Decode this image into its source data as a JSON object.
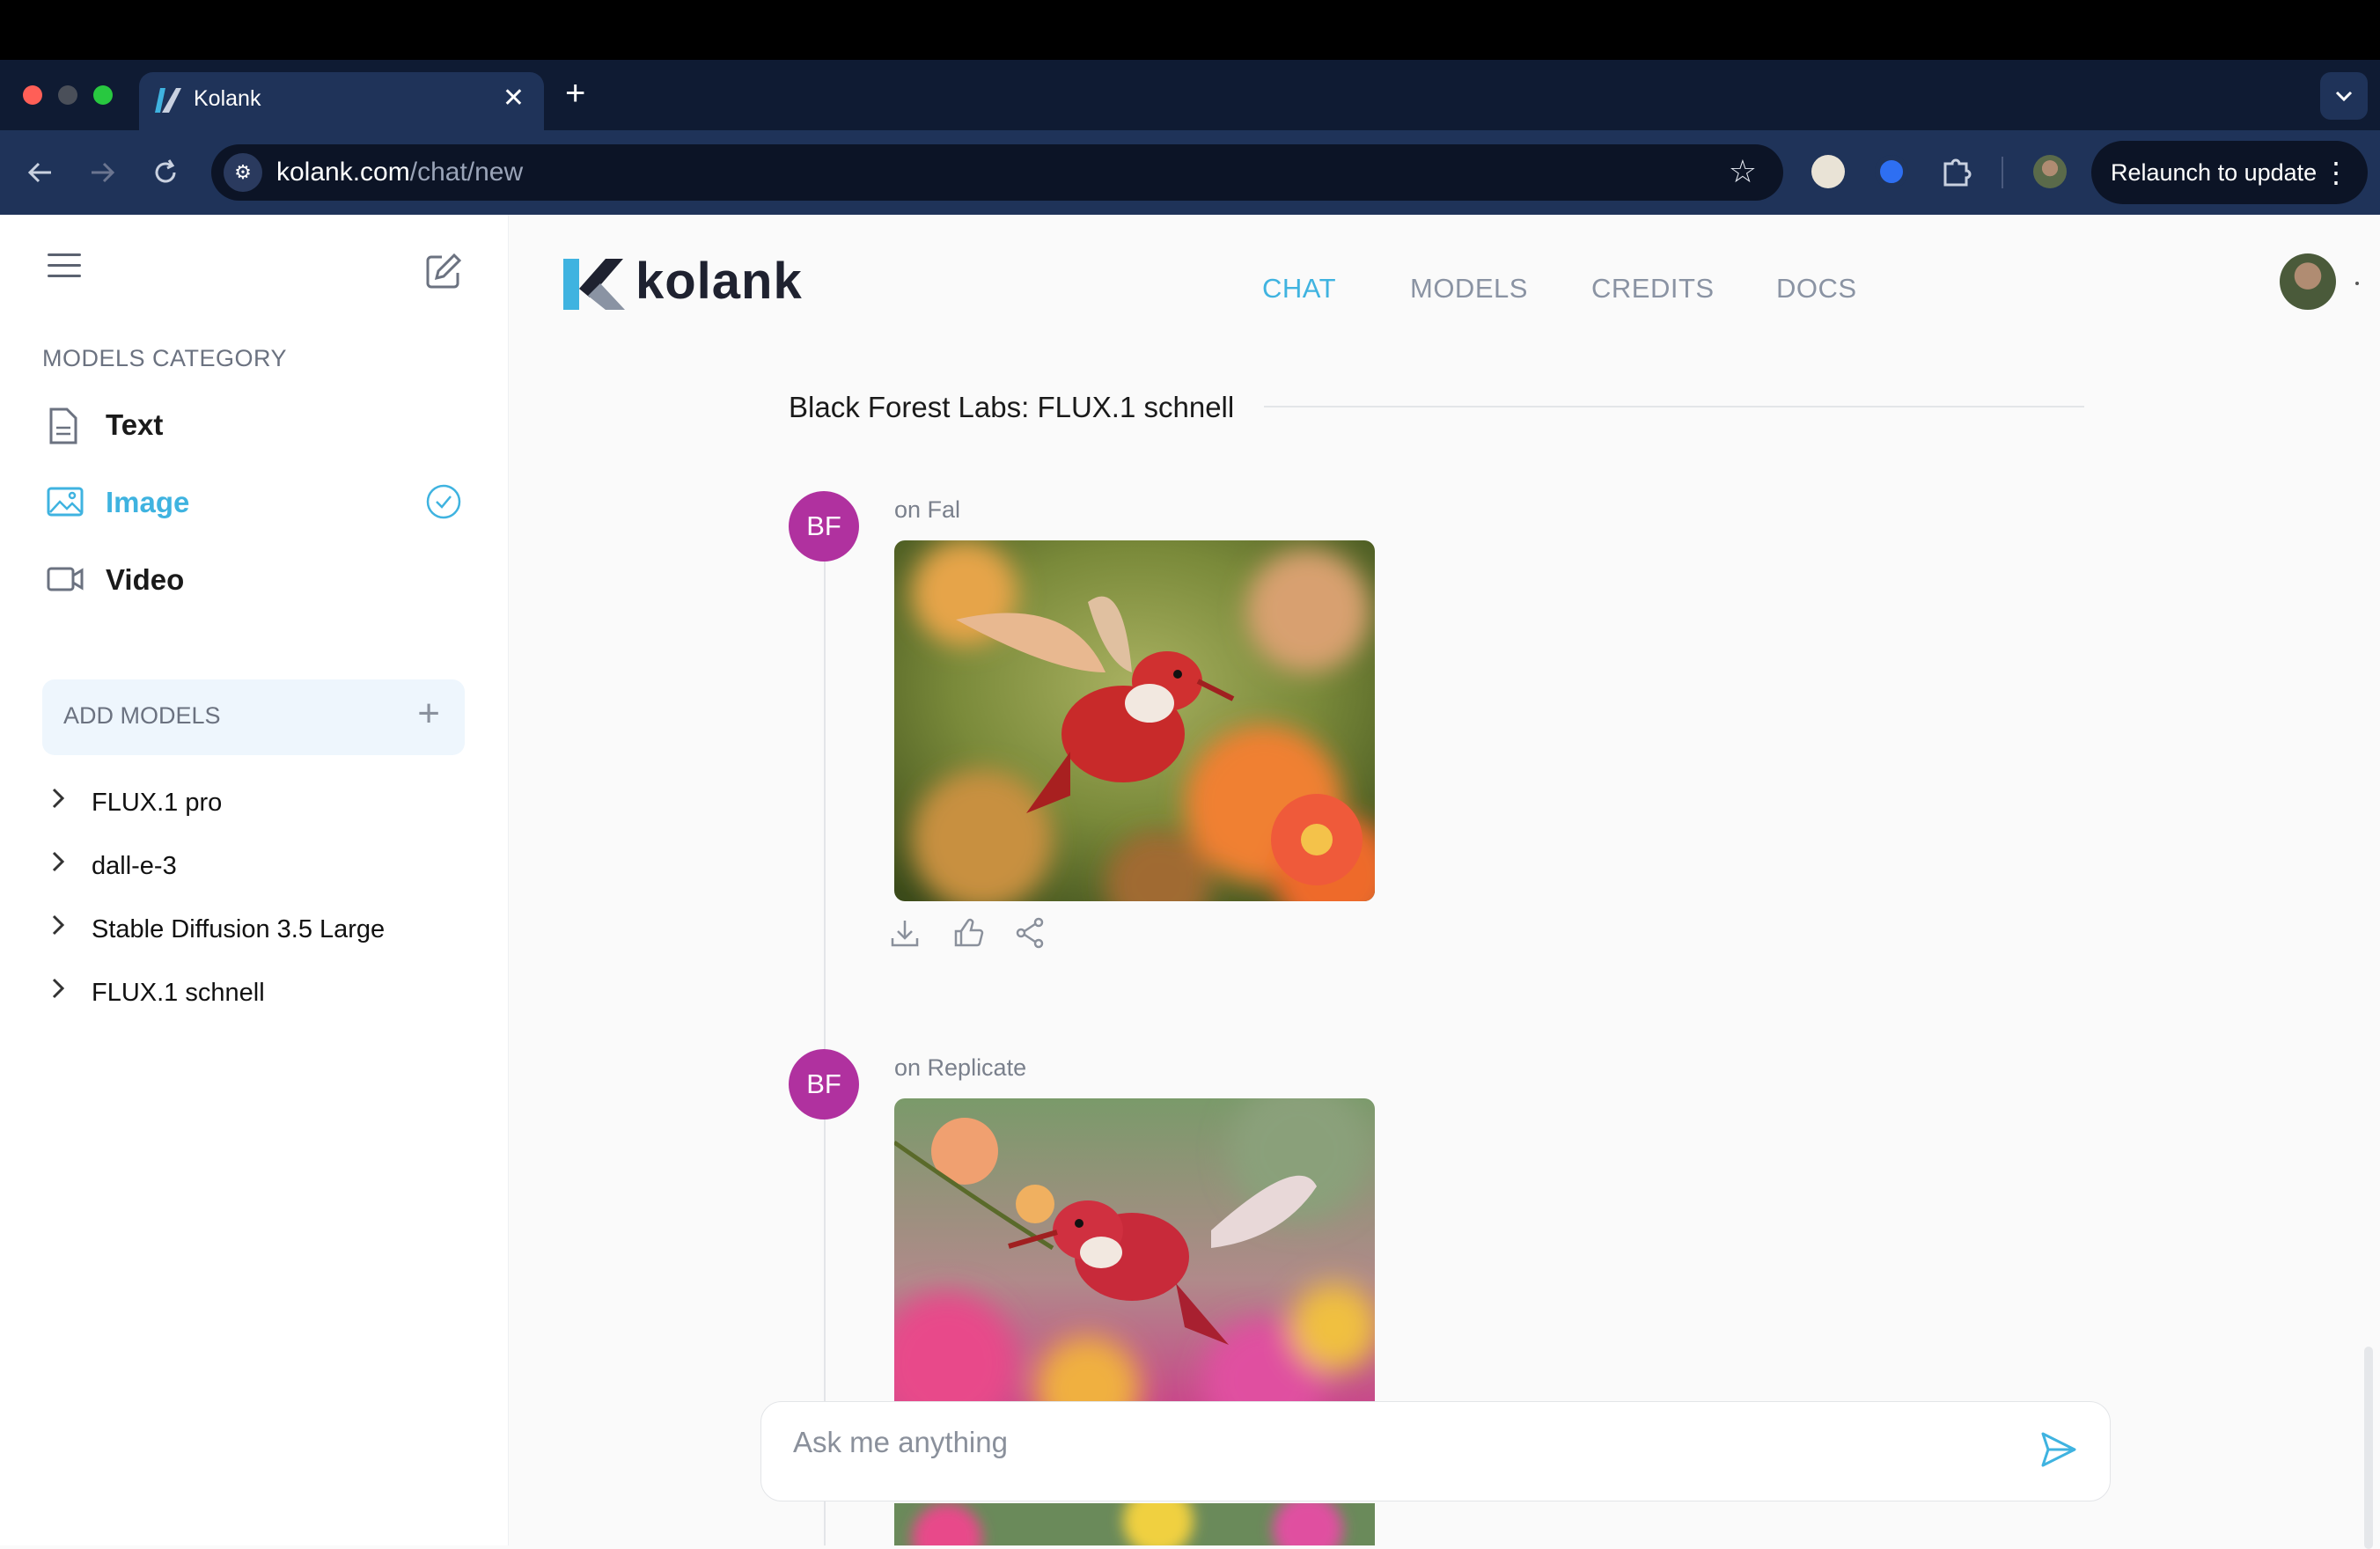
{
  "browser": {
    "tab_title": "Kolank",
    "url_host": "kolank.com",
    "url_path": "/chat/new",
    "relaunch_label": "Relaunch to update",
    "tab_close": "✕",
    "new_tab": "+",
    "menu_dots": "⋮"
  },
  "sidebar": {
    "models_category_label": "MODELS CATEGORY",
    "categories": [
      {
        "label": "Text",
        "icon": "document-icon",
        "selected": false
      },
      {
        "label": "Image",
        "icon": "image-icon",
        "selected": true
      },
      {
        "label": "Video",
        "icon": "video-icon",
        "selected": false
      }
    ],
    "add_models_label": "ADD MODELS",
    "models": [
      {
        "label": "FLUX.1 pro"
      },
      {
        "label": "dall-e-3"
      },
      {
        "label": "Stable Diffusion 3.5 Large"
      },
      {
        "label": "FLUX.1 schnell"
      }
    ]
  },
  "header": {
    "logo_text": "kolank",
    "nav": [
      {
        "label": "CHAT",
        "active": true
      },
      {
        "label": "MODELS",
        "active": false
      },
      {
        "label": "CREDITS",
        "active": false
      },
      {
        "label": "DOCS",
        "active": false
      }
    ]
  },
  "chat": {
    "section_title": "Black Forest Labs: FLUX.1 schnell",
    "messages": [
      {
        "avatar": "BF",
        "source": "on Fal",
        "image_subject": "red hummingbird flying over orange flowers"
      },
      {
        "avatar": "BF",
        "source": "on Replicate",
        "image_subject": "red hummingbird near pink flowers"
      }
    ],
    "input_placeholder": "Ask me anything"
  },
  "colors": {
    "accent": "#3fb3e0",
    "avatar_bg": "#b0319f",
    "chrome_dark": "#0f1b33",
    "toolbar": "#1f3359"
  }
}
